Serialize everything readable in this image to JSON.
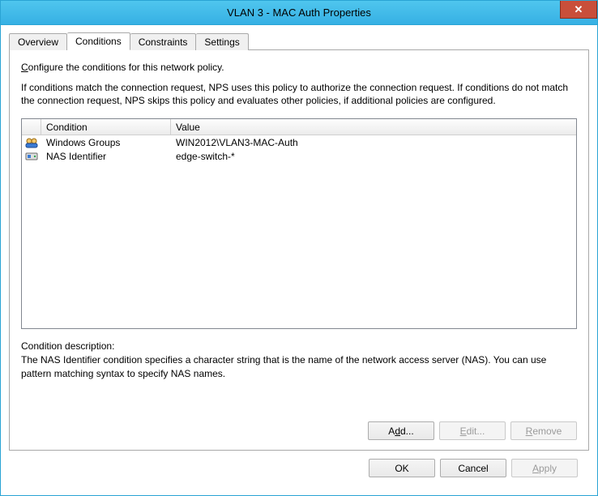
{
  "window": {
    "title": "VLAN 3 - MAC Auth Properties",
    "close_glyph": "✕"
  },
  "tabs": {
    "overview": "Overview",
    "conditions": "Conditions",
    "constraints": "Constraints",
    "settings": "Settings"
  },
  "intro": {
    "line1_pre": "C",
    "line1_rest": "onfigure the conditions for this network policy.",
    "line2": "If conditions match the connection request, NPS uses this policy to authorize the connection request. If conditions do not match the connection request, NPS skips this policy and evaluates other policies, if additional policies are configured."
  },
  "list": {
    "headers": {
      "col_icon": "",
      "col_condition": "Condition",
      "col_value": "Value"
    },
    "rows": [
      {
        "icon": "groups",
        "condition": "Windows Groups",
        "value": "WIN2012\\VLAN3-MAC-Auth"
      },
      {
        "icon": "nas",
        "condition": "NAS Identifier",
        "value": "edge-switch-*"
      }
    ]
  },
  "description": {
    "label": "Condition description:",
    "text": "The NAS Identifier condition specifies a character string that is the name of the network access server (NAS). You can use pattern matching syntax to specify NAS names."
  },
  "buttons": {
    "add": "Add...",
    "edit": "Edit...",
    "remove": "Remove",
    "ok": "OK",
    "cancel": "Cancel",
    "apply": "Apply"
  },
  "mnemonics": {
    "add_pre": "A",
    "add_u": "d",
    "add_post": "d...",
    "edit_u": "E",
    "edit_post": "dit...",
    "remove_u": "R",
    "remove_post": "emove",
    "apply_u": "A",
    "apply_post": "pply"
  }
}
